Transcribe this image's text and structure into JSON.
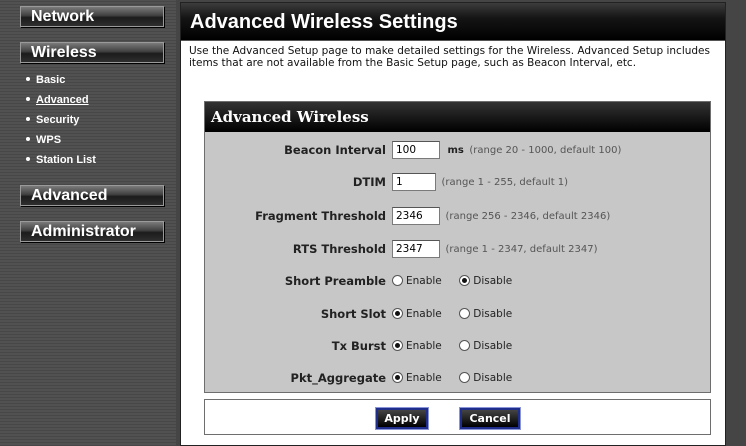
{
  "sidebar": {
    "menus": [
      {
        "label": "Network"
      },
      {
        "label": "Wireless"
      },
      {
        "label": "Advanced"
      },
      {
        "label": "Administrator"
      }
    ],
    "wireless_items": [
      {
        "label": "Basic"
      },
      {
        "label": "Advanced"
      },
      {
        "label": "Security"
      },
      {
        "label": "WPS"
      },
      {
        "label": "Station List"
      }
    ]
  },
  "page": {
    "title": "Advanced Wireless Settings",
    "description": "Use the Advanced Setup page to make detailed settings for the Wireless. Advanced Setup includes items that are not available from the Basic Setup page, such as Beacon Interval, etc."
  },
  "panel": {
    "title": "Advanced Wireless",
    "fields": {
      "beacon": {
        "label": "Beacon Interval",
        "value": "100",
        "unit": "ms",
        "hint": "(range 20 - 1000, default 100)"
      },
      "dtim": {
        "label": "DTIM",
        "value": "1",
        "hint": "(range 1 - 255, default 1)"
      },
      "fragment": {
        "label": "Fragment Threshold",
        "value": "2346",
        "hint": "(range 256 - 2346, default 2346)"
      },
      "rts": {
        "label": "RTS Threshold",
        "value": "2347",
        "hint": "(range 1 - 2347, default 2347)"
      }
    },
    "radios": {
      "enable_label": "Enable",
      "disable_label": "Disable",
      "short_preamble": {
        "label": "Short Preamble",
        "selected": "Disable"
      },
      "short_slot": {
        "label": "Short Slot",
        "selected": "Enable"
      },
      "tx_burst": {
        "label": "Tx Burst",
        "selected": "Enable"
      },
      "pkt_aggregate": {
        "label": "Pkt_Aggregate",
        "selected": "Enable"
      }
    }
  },
  "buttons": {
    "apply": "Apply",
    "cancel": "Cancel"
  }
}
